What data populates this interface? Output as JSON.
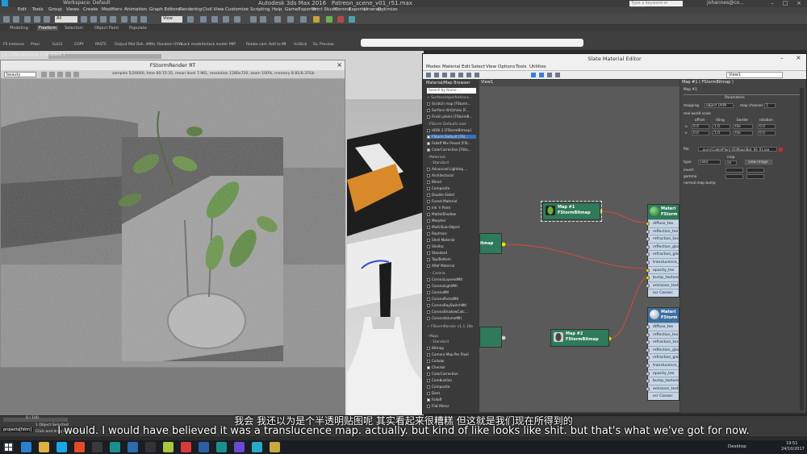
{
  "window": {
    "app_title": "Autodesk 3ds Max 2016",
    "file_name": "Patreon_scene_v01_r51.max",
    "workspace": "Workspace: Default",
    "search_placeholder": "Type a keyword or phrase",
    "user": "johannes@co..."
  },
  "menubar": [
    "Edit",
    "Tools",
    "Group",
    "Views",
    "Create",
    "Modifiers",
    "Animation",
    "Graph Editors",
    "Rendering",
    "Civil View",
    "Customize",
    "Scripting",
    "Help",
    "GameExporter",
    "Print Studio",
    "Corona",
    "Exporter",
    "Unwrap",
    "Optimize"
  ],
  "toolbar": {
    "selection_filter": "All",
    "view": "View"
  },
  "ribbon_tabs": [
    "Modeling",
    "Freeform",
    "Selection",
    "Object Paint",
    "Populate"
  ],
  "ribbon_tools": [
    "FS Instance",
    "Proxi",
    "ILLU3",
    "COPY",
    "PASTE",
    "Output Mat",
    "Dsh. dMtls",
    "Random UVW",
    "Lock model",
    "Unlock model",
    "MIP",
    "Rotate cam",
    "Add to Mt",
    "UvSlick",
    "Sv. Preview"
  ],
  "viewport": {
    "label": "[+] [Perspective ] [Shaded ]"
  },
  "fstorm": {
    "title": "FStormRender RT",
    "channel": "beauty",
    "stats": "samples 5/20000,  time 00:15:35,  mean level 7.961,  resolution 1280x720,  zoom 100%,  memory 8.81/8.37Gb"
  },
  "sme": {
    "title": "Slate Material Editor",
    "menu": [
      "Modes",
      "Material",
      "Edit",
      "Select",
      "View",
      "Options",
      "Tools",
      "Utilities"
    ],
    "view_tab": "View1",
    "view_dropdown": "View1",
    "browser_title": "Material/Map Browser",
    "browser_search": "Search by Name ...",
    "browser_groups": [
      {
        "header": "+ Surfaceimperfections...",
        "items": [
          "Scratch map [FStorm...",
          "Surface dirt[shaiu [F...",
          "Finish plains [FStormB..."
        ]
      },
      {
        "header": "- FStorm Defaults.mat",
        "items": [
          "HDRI 2 [FStormBitmap]",
          "FStorm Default [FSt...",
          "Falloff Mix Preset [FSt...",
          "ColorCorrection [FSto..."
        ]
      },
      {
        "header": "- Materials",
        "items": []
      },
      {
        "header": "- Standard",
        "items": [
          "Advanced Lighting ...",
          "Architectural",
          "Blend",
          "Composite",
          "Double Sided",
          "Forest Material",
          "Ink 'n Paint",
          "Matte/Shadow",
          "Morpher",
          "Multi/Sub-Object",
          "Raytrace",
          "Shell Material",
          "Shellac",
          "Standard",
          "Top/Bottom",
          "XRef Material"
        ]
      },
      {
        "header": "- Corona",
        "items": [
          "CoronaLayeredMtl",
          "CoronaLightMtl",
          "CoronaMtl",
          "CoronaPortalMtl",
          "CoronaRaySwitchMtl",
          "CoronaShadowCatc...",
          "CoronaVolumeMtl"
        ]
      },
      {
        "header": "+ FStormRender v1.1.10b",
        "items": []
      },
      {
        "header": "- Maps",
        "items": []
      },
      {
        "header": "- Standard",
        "items": [
          "Bitmap",
          "Camera Map Per Pixel",
          "Cellular",
          "Checker",
          "ColorCorrection",
          "Combustion",
          "Composite",
          "Dent",
          "Falloff",
          "Flat Mirror"
        ]
      }
    ],
    "params": {
      "title": "Map #1 ( FStormBitmap )",
      "subtitle": "Map #1",
      "section": "Parameters",
      "mapping_label": "mapping",
      "mapping_value": "object UVW",
      "map_channel_label": "map channel",
      "map_channel_value": "1",
      "real_world_label": "real world scale",
      "offset_label": "offset",
      "tiling_label": "tiling",
      "border_label": "border",
      "rotation_label": "rotation",
      "u_label": "u",
      "v_label": "v",
      "offset_u": "0.0",
      "offset_v": "0.0",
      "tiling_u": "1.0",
      "tiling_v": "1.0",
      "border_u": "tile",
      "border_v": "tile",
      "rotation_u": "0.0",
      "rotation_v": "0.0",
      "file_label": "file",
      "file_value": "...ourrs\\Cable\\Plant 03\\Maps\\Bot_93_01.jpg",
      "type_label": "type",
      "type_value": "color",
      "crop_label": "crop",
      "crop_value": "on",
      "view_image_label": "view image",
      "invert_label": "invert",
      "gamma_label": "gamma",
      "normal_bump_label": "normal map bump"
    },
    "nodes": {
      "map1": {
        "line1": "Map #1",
        "line2": "FStormBitmap"
      },
      "map2": {
        "line1": "Map #2",
        "line2": "FStormBitmap"
      },
      "left_stub_top": "itmap",
      "left_stub_bottom": "",
      "mat1_title": "Materi",
      "mat1_sub": "FStorm",
      "mat1_slots": [
        "diffuse_tex",
        "reflection_tex",
        "refraction_tex",
        "reflection_glos",
        "refraction_glos",
        "translucence_te",
        "opacity_tex",
        "bump_texture",
        "emission_textu",
        "ssr Coeasc"
      ],
      "mat2_title": "Materi",
      "mat2_sub": "FStorm",
      "mat2_slots": [
        "diffuse_tex",
        "reflection_tex",
        "refraction_tex",
        "reflection_glos",
        "refraction_glos",
        "translucence_te",
        "opacity_tex",
        "bump_texture",
        "emission_textu",
        "ssr Coeasc"
      ]
    }
  },
  "statusbar": {
    "selected": "1 Object Selected",
    "prompt": "Click and drag to select an...",
    "time": "0 / 100",
    "left_label": "projects[fstm]"
  },
  "taskbar": {
    "desktop_label": "Desktop",
    "clock_time": "19:51",
    "clock_date": "24/10/2017"
  },
  "subtitles": {
    "chinese": "我会 我还以为是个半透明贴图呢 其实看起来很糟糕 但这就是我们现在所得到的",
    "english": "I would. I would have believed it was a translucence map. actually. but kind of like looks like shit. but that's what we've got for now."
  },
  "colors": {
    "node_head": "#2e7a5a",
    "wire": "#d9483b",
    "slot_bg": "#c6d4e6",
    "slot_active": "#e6e600",
    "sme_view_bg": "#5a5a5a"
  }
}
